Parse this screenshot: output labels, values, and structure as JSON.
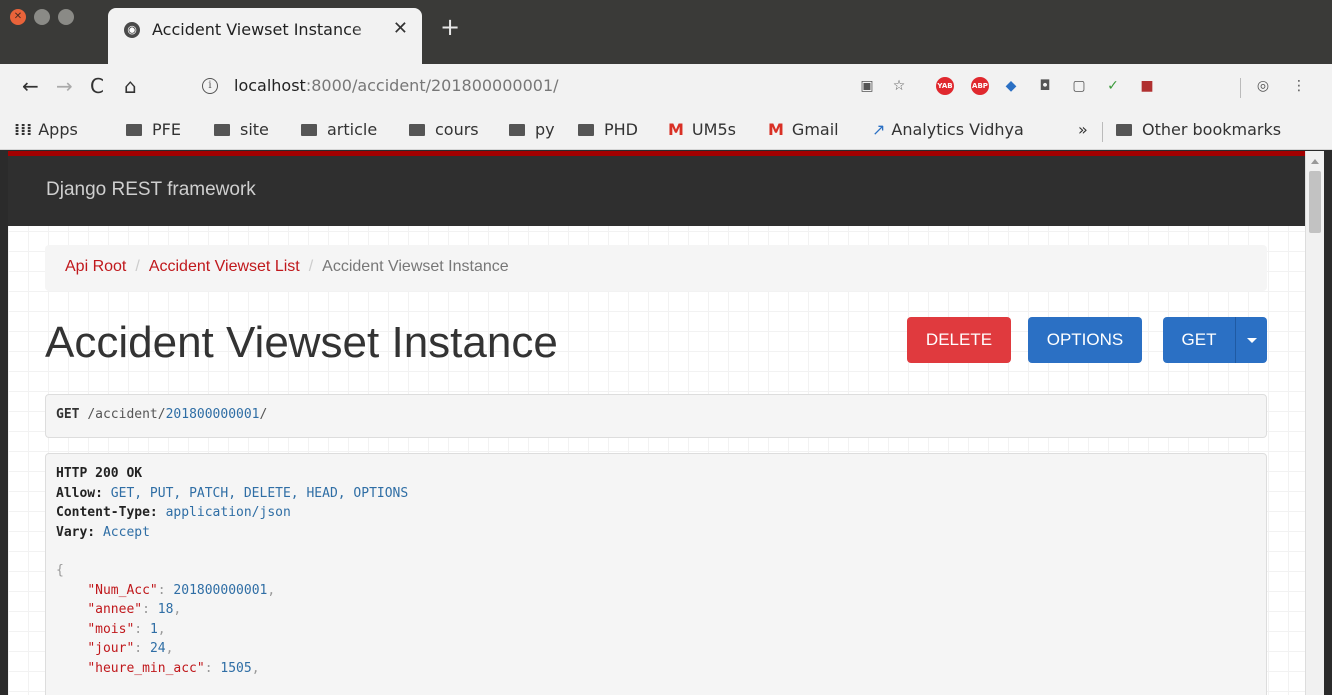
{
  "browser": {
    "tab_title": "Accident Viewset Instance",
    "url_host": "localhost",
    "url_rest": ":8000/accident/201800000001/",
    "extensions": [
      "YAB",
      "ABP"
    ]
  },
  "bookmarks": {
    "apps": "Apps",
    "items": [
      "PFE",
      "site",
      "article",
      "cours",
      "py",
      "PHD"
    ],
    "gmail_items": [
      "UM5s",
      "Gmail"
    ],
    "analytics": "Analytics Vidhya",
    "more": "»",
    "other": "Other bookmarks"
  },
  "app": {
    "brand": "Django REST framework"
  },
  "breadcrumb": {
    "root": "Api Root",
    "list": "Accident Viewset List",
    "current": "Accident Viewset Instance"
  },
  "page": {
    "title": "Accident Viewset Instance",
    "delete_label": "DELETE",
    "options_label": "OPTIONS",
    "get_label": "GET"
  },
  "request": {
    "method": "GET",
    "path": "/accident/",
    "id": "201800000001",
    "trail": "/"
  },
  "response": {
    "status": "HTTP 200 OK",
    "headers": [
      {
        "key": "Allow:",
        "value": "GET, PUT, PATCH, DELETE, HEAD, OPTIONS"
      },
      {
        "key": "Content-Type:",
        "value": "application/json"
      },
      {
        "key": "Vary:",
        "value": "Accept"
      }
    ],
    "open_brace": "{",
    "fields": [
      {
        "key": "\"Num_Acc\"",
        "value": "201800000001"
      },
      {
        "key": "\"annee\"",
        "value": "18"
      },
      {
        "key": "\"mois\"",
        "value": "1"
      },
      {
        "key": "\"jour\"",
        "value": "24"
      },
      {
        "key": "\"heure_min_acc\"",
        "value": "1505"
      }
    ]
  },
  "colors": {
    "accent_red": "#c0181c",
    "navbar": "#2f2f2f",
    "delete": "#e03a3e",
    "primary": "#2b70c4"
  }
}
